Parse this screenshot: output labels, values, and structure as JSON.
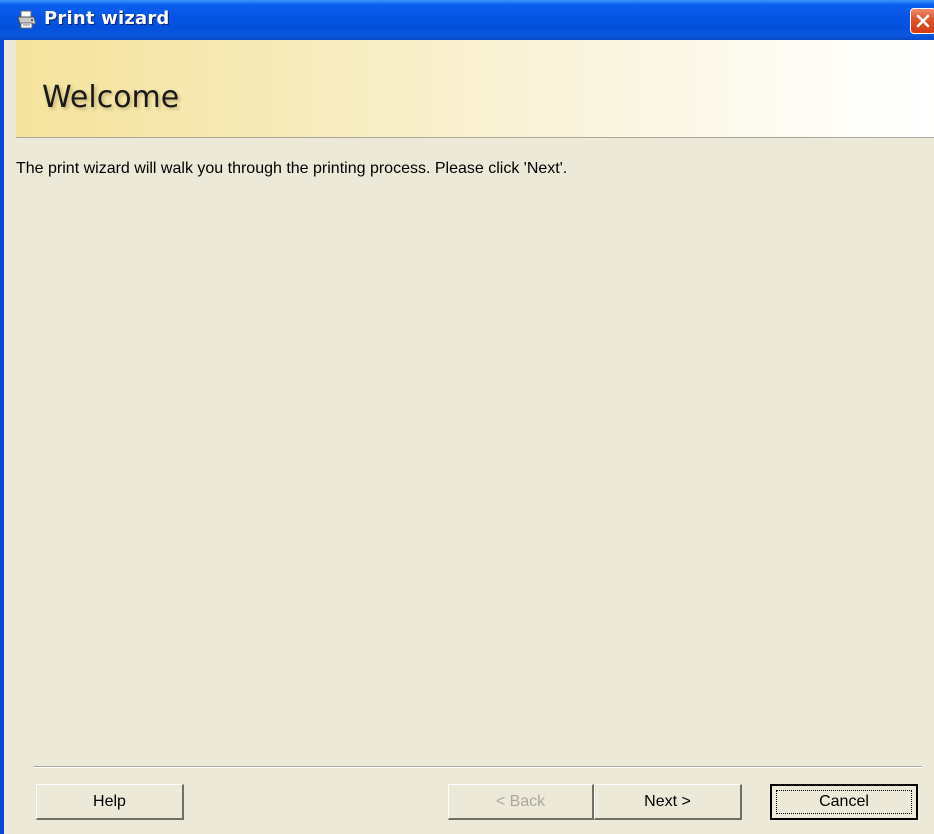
{
  "window": {
    "title": "Print wizard",
    "close_icon": "close-icon"
  },
  "header": {
    "title": "Welcome"
  },
  "main": {
    "message": "The print wizard will walk you through the printing process. Please click 'Next'."
  },
  "footer": {
    "help_label": "Help",
    "back_label": "< Back",
    "next_label": "Next >",
    "cancel_label": "Cancel"
  },
  "colors": {
    "titlebar": "#0454e4",
    "window_bg": "#ece9d8",
    "header_gradient_start": "#f4e39c",
    "close_button": "#e0512c"
  }
}
